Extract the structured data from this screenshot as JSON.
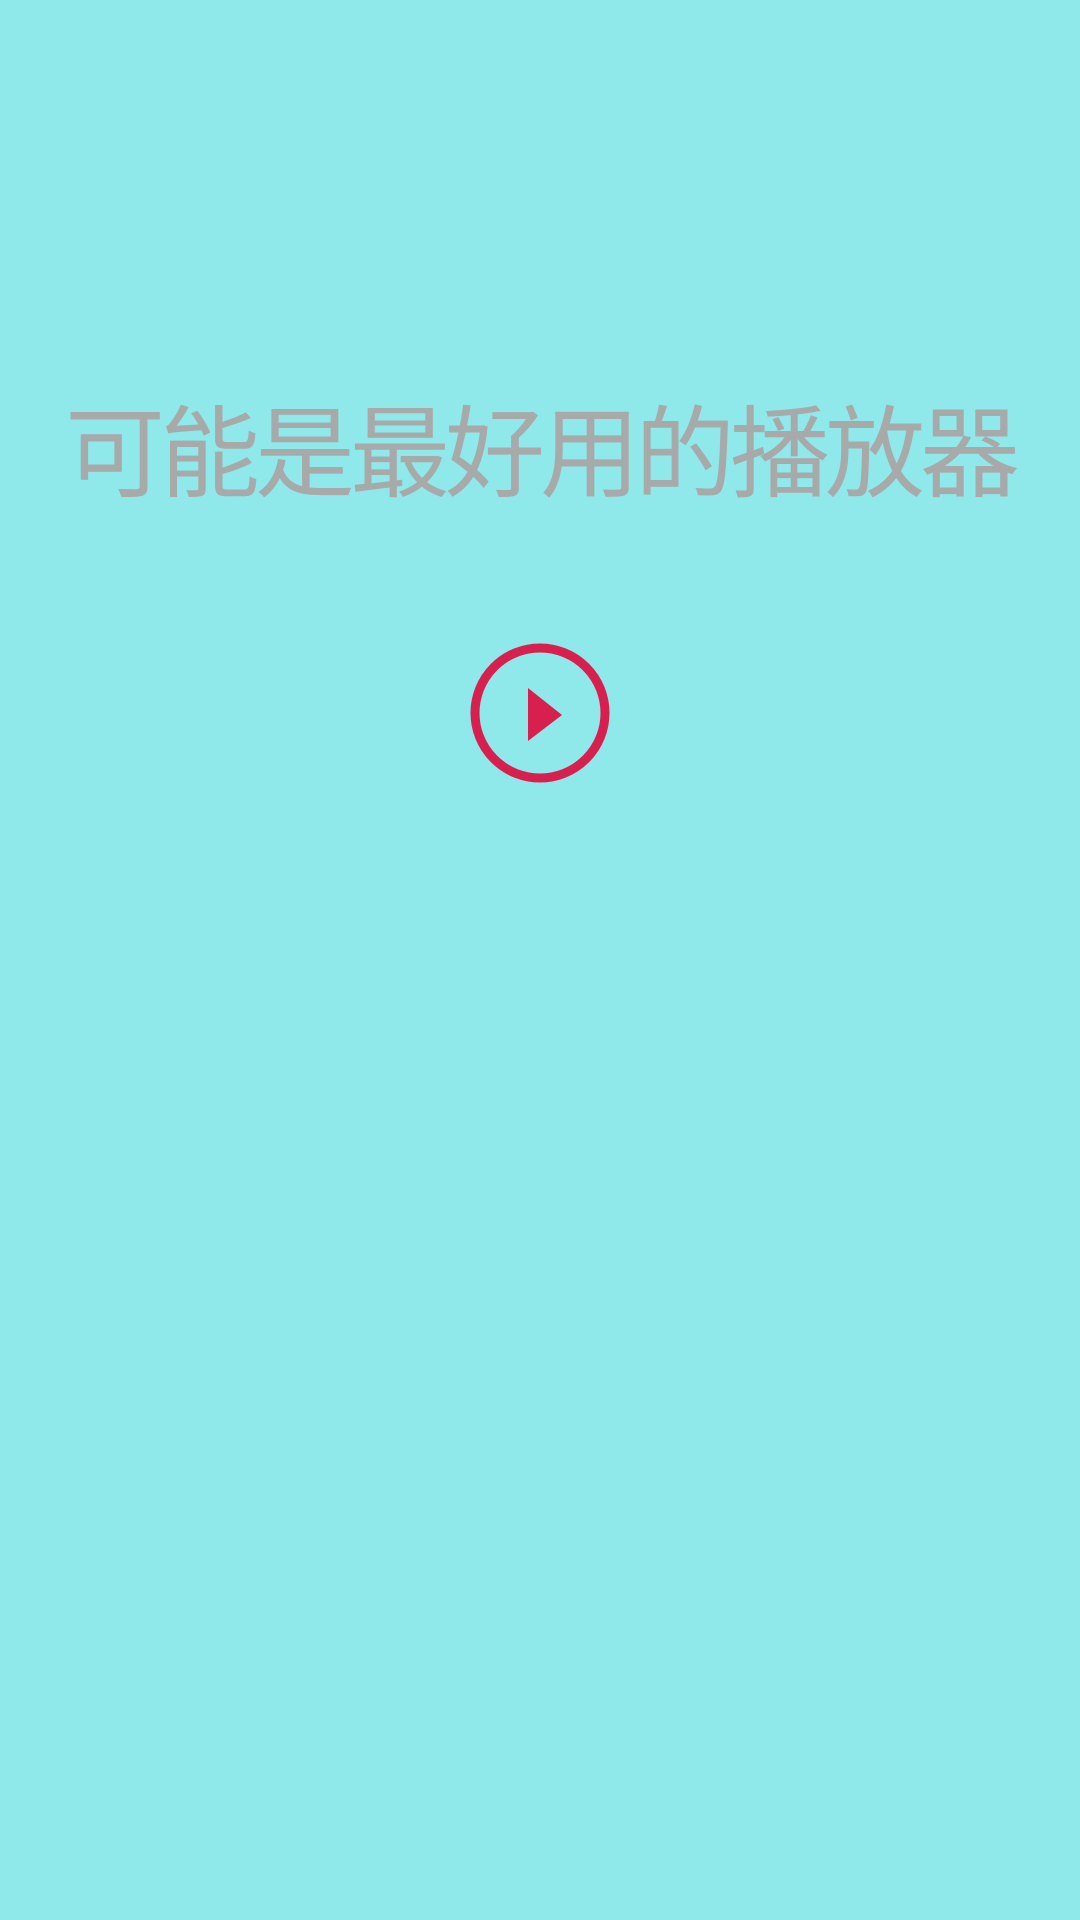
{
  "app": {
    "tagline": "可能是最好用的播放器"
  },
  "play_button": {
    "icon": "play-circle-icon",
    "aria_label": "播放"
  },
  "colors": {
    "background": "#8fe8ea",
    "tagline_text": "#a8aaa9",
    "accent": "#d7204d"
  }
}
